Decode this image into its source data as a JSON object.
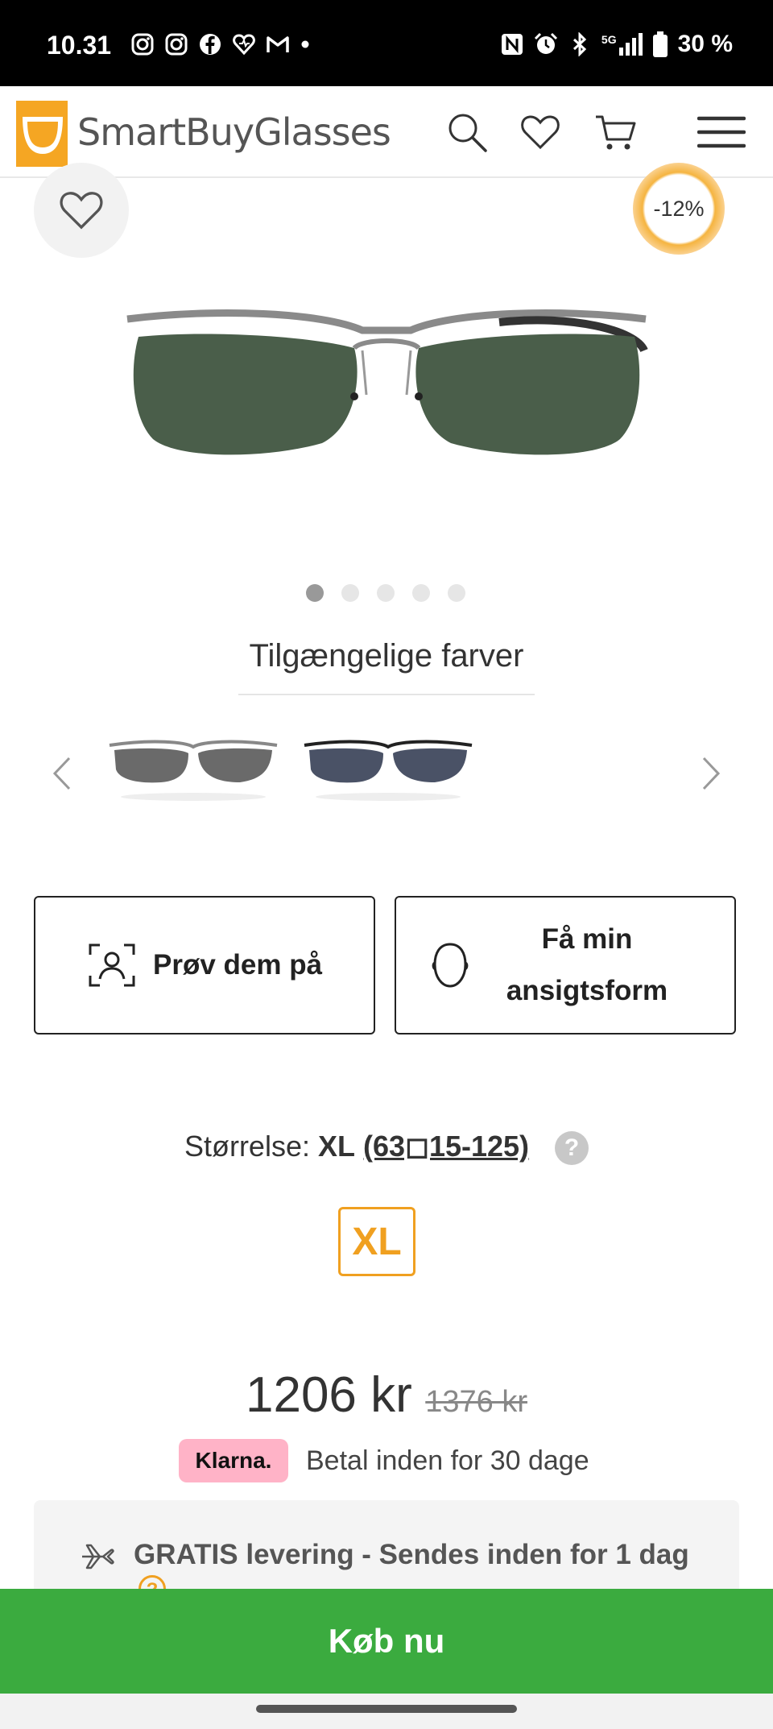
{
  "status_bar": {
    "time": "10.31",
    "left_icons": [
      "instagram-icon",
      "instagram-icon",
      "facebook-icon",
      "heart-app-icon",
      "gmail-icon",
      "dot-icon"
    ],
    "right_icons": [
      "nfc-icon",
      "alarm-icon",
      "bluetooth-icon",
      "signal-5g-icon",
      "battery-icon"
    ],
    "network": "5G",
    "battery": "30 %"
  },
  "header": {
    "logo_text": "SmartBuyGlasses",
    "icons": [
      "search-icon",
      "heart-icon",
      "cart-icon",
      "menu-icon"
    ]
  },
  "product": {
    "discount": "-12%",
    "gallery_total": 5,
    "gallery_active": 1
  },
  "colors": {
    "title": "Tilgængelige farver",
    "swatches": [
      "gunmetal-green-lens",
      "black-blue-lens"
    ]
  },
  "actions": {
    "try_on": "Prøv dem på",
    "face_shape_line1": "Få min",
    "face_shape_line2": "ansigtsform"
  },
  "size": {
    "label": "Størrelse:",
    "value": "XL",
    "dims": "(63◻15-125)",
    "help": "?",
    "chip": "XL"
  },
  "price": {
    "current": "1206 kr",
    "old": "1376 kr"
  },
  "klarna": {
    "badge": "Klarna.",
    "text": "Betal inden for 30 dage"
  },
  "shipping": {
    "text": "GRATIS levering - Sendes inden for 1 dag",
    "help": "?"
  },
  "buy": {
    "label": "Køb nu"
  },
  "colors_palette": {
    "accent_orange": "#f0a020",
    "buy_green": "#3bab3f",
    "klarna_pink": "#ffb3c7"
  }
}
